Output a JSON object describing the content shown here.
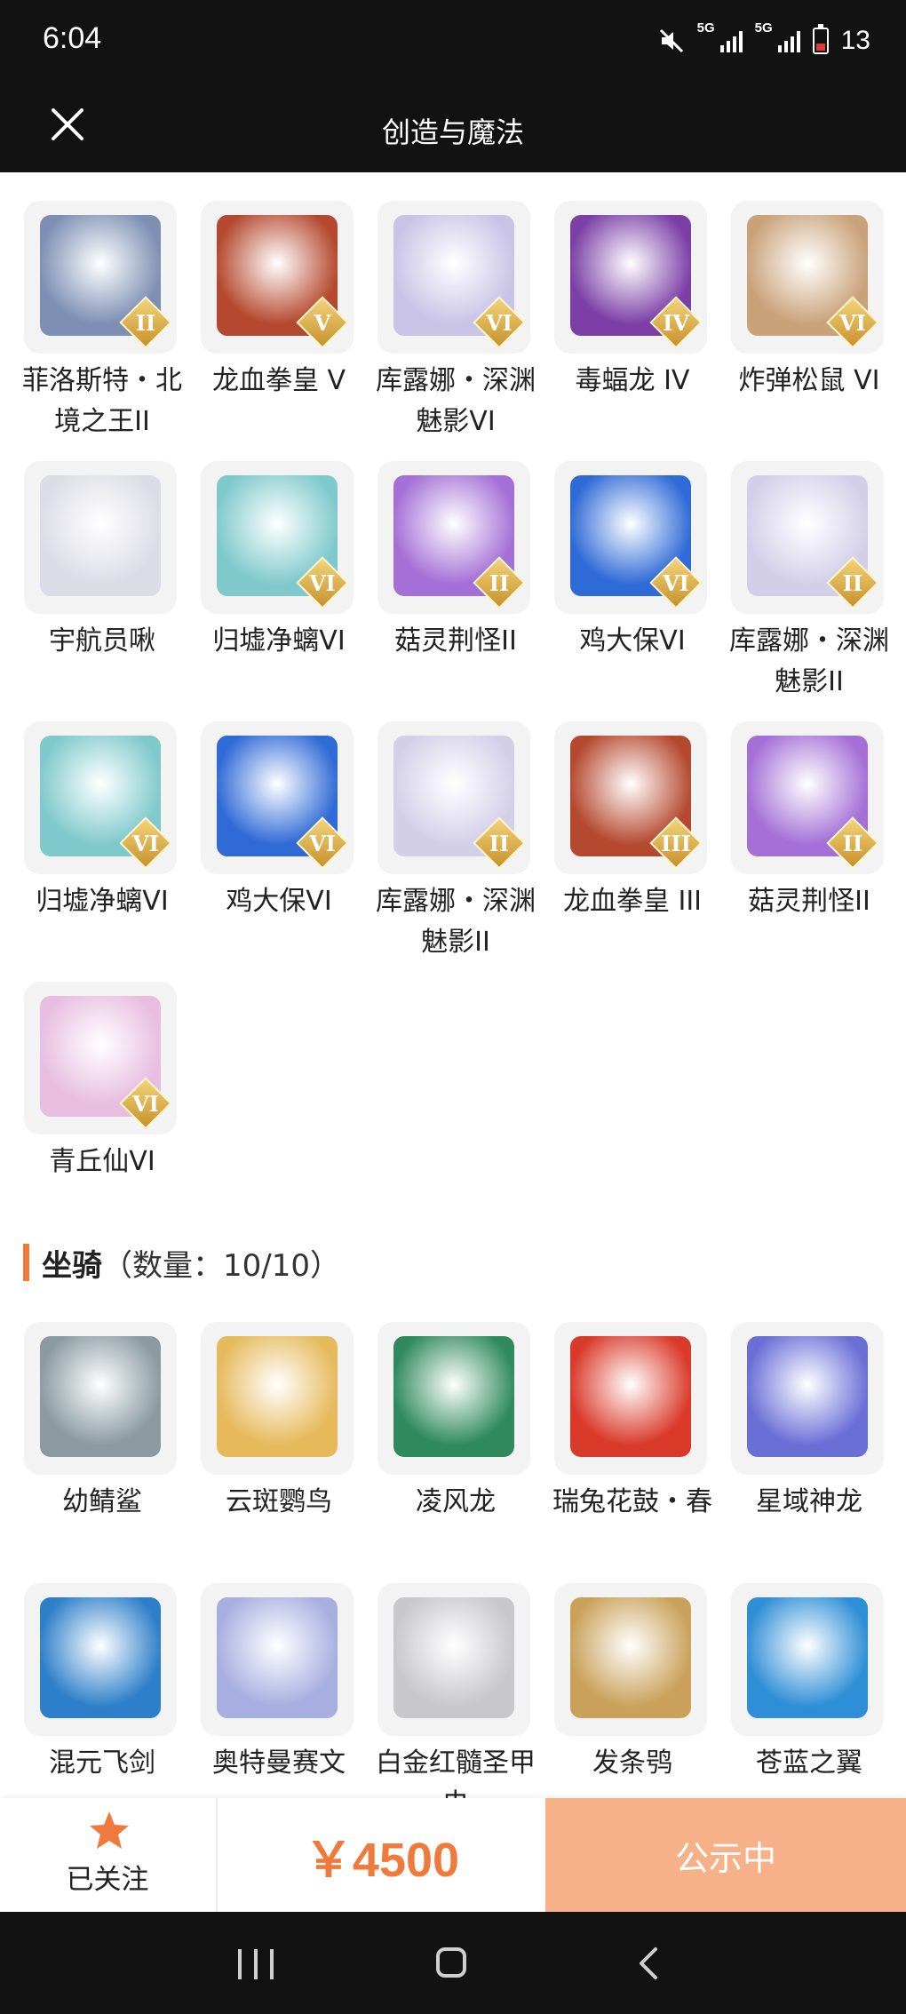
{
  "status_bar": {
    "time": "6:04",
    "network1": "5G",
    "network2": "5G",
    "battery": "13"
  },
  "header": {
    "title": "创造与魔法"
  },
  "pets": [
    {
      "name": "菲洛斯特・北境之王II",
      "badge": "II",
      "color": "#7d8fb3"
    },
    {
      "name": "龙血拳皇 V",
      "badge": "V",
      "color": "#b5492f"
    },
    {
      "name": "库露娜・深渊魅影VI",
      "badge": "VI",
      "color": "#c9c3e6"
    },
    {
      "name": "毒蝠龙 IV",
      "badge": "IV",
      "color": "#7b3fa6"
    },
    {
      "name": "炸弹松鼠 VI",
      "badge": "VI",
      "color": "#c9a27a"
    },
    {
      "name": "宇航员啾",
      "badge": "",
      "color": "#dcdce6"
    },
    {
      "name": "归墟净螭VI",
      "badge": "VI",
      "color": "#7fc9cc"
    },
    {
      "name": "菇灵荆怪II",
      "badge": "II",
      "color": "#a46fd6"
    },
    {
      "name": "鸡大保VI",
      "badge": "VI",
      "color": "#2f6ad6"
    },
    {
      "name": "库露娜・深渊魅影II",
      "badge": "II",
      "color": "#d4cfe9"
    },
    {
      "name": "归墟净螭VI",
      "badge": "VI",
      "color": "#7fc9cc"
    },
    {
      "name": "鸡大保VI",
      "badge": "VI",
      "color": "#2f6ad6"
    },
    {
      "name": "库露娜・深渊魅影II",
      "badge": "II",
      "color": "#d4cfe9"
    },
    {
      "name": "龙血拳皇 III",
      "badge": "III",
      "color": "#b5492f"
    },
    {
      "name": "菇灵荆怪II",
      "badge": "II",
      "color": "#a46fd6"
    },
    {
      "name": "青丘仙VI",
      "badge": "VI",
      "color": "#e7bde0"
    }
  ],
  "mounts_section": {
    "title": "坐骑",
    "count": "（数量：10/10）"
  },
  "mounts": [
    {
      "name": "幼鲭鲨",
      "color": "#8a9aa0"
    },
    {
      "name": "云斑鹦鸟",
      "color": "#e6b95a"
    },
    {
      "name": "凌风龙",
      "color": "#2f8a5e"
    },
    {
      "name": "瑞兔花鼓・春",
      "color": "#d93a2a"
    },
    {
      "name": "星域神龙",
      "color": "#6a6fd6"
    },
    {
      "name": "混元飞剑",
      "color": "#2d7fc9"
    },
    {
      "name": "奥特曼赛文",
      "color": "#a7aee0"
    },
    {
      "name": "白金红髓圣甲虫",
      "color": "#c7c7cc"
    },
    {
      "name": "发条鸮",
      "color": "#c9a15a"
    },
    {
      "name": "苍蓝之翼",
      "color": "#2f8fd6"
    }
  ],
  "bottom_bar": {
    "follow_label": "已关注",
    "price": "￥4500",
    "status_button": "公示中"
  },
  "colors": {
    "accent": "#f07a3c",
    "status_button_bg": "#f7b189"
  }
}
